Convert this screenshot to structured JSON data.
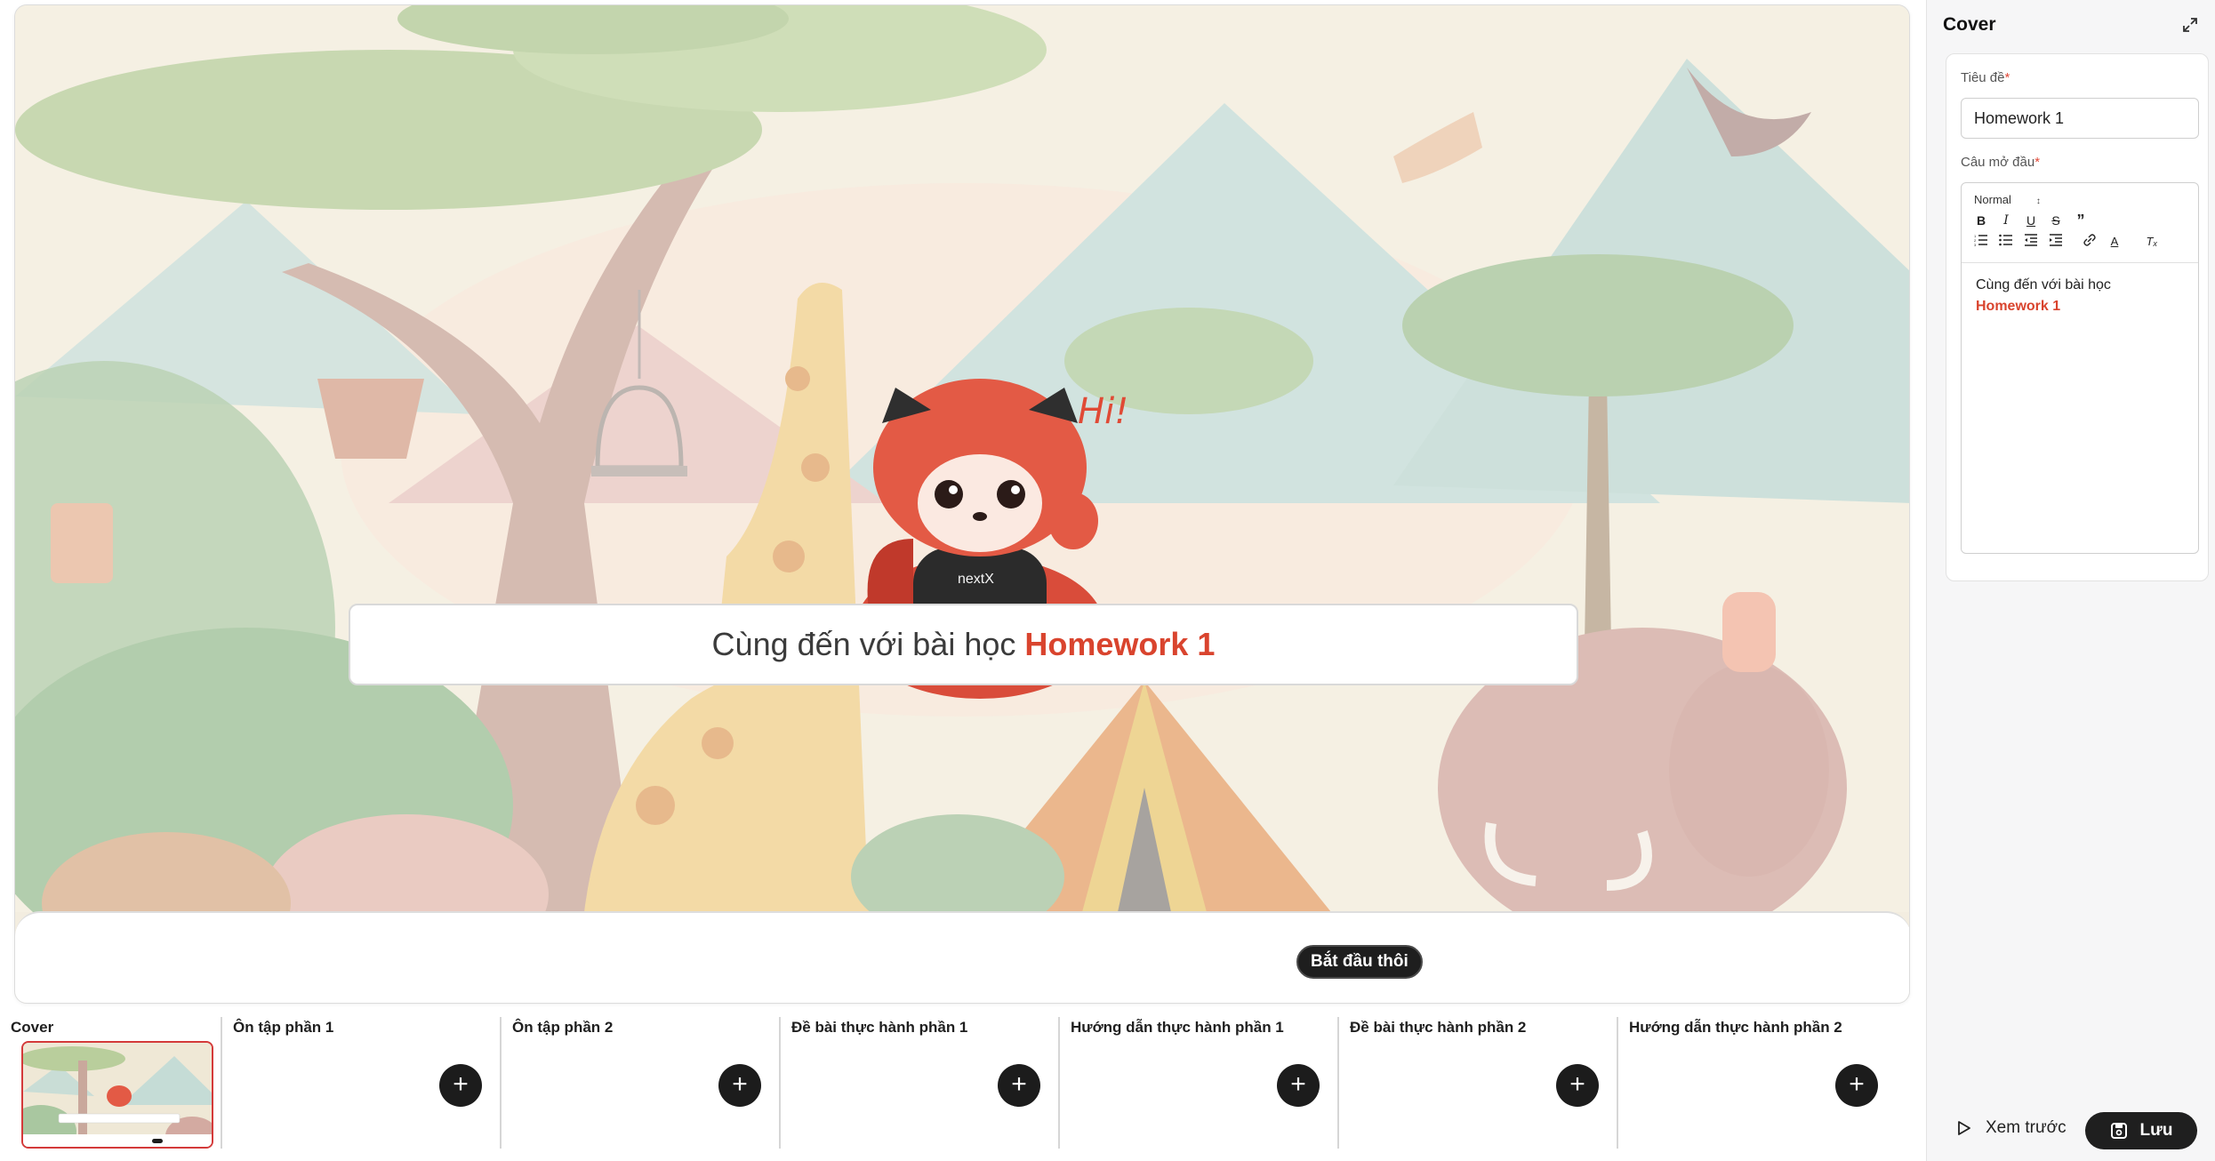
{
  "stage": {
    "greeting_prefix": "Cùng đến với bài học",
    "greeting_highlight": "Homework 1",
    "start_button": "Bắt đầu thôi",
    "mascot_bubble": "Hi!",
    "shirt_logo": "nextX"
  },
  "slides": [
    {
      "label": "Cover"
    },
    {
      "label": "Ôn tập phần 1"
    },
    {
      "label": "Ôn tập phần 2"
    },
    {
      "label": "Đề bài thực hành phần 1"
    },
    {
      "label": "Hướng dẫn thực hành phần 1"
    },
    {
      "label": "Đề bài thực hành phần 2"
    },
    {
      "label": "Hướng dẫn thực hành phần 2"
    }
  ],
  "add_symbol": "+",
  "panel": {
    "title": "Cover",
    "title_label": "Tiêu đề",
    "title_value": "Homework 1",
    "intro_label": "Câu mở đầu",
    "required_mark": "*",
    "format_select": "Normal",
    "intro_text": "Cùng đến với bài học",
    "intro_highlight": "Homework 1",
    "preview_button": "Xem trước",
    "save_button": "Lưu"
  },
  "colors": {
    "accent_red": "#d9442e",
    "dark_button": "#1f1f1f",
    "selected_border": "#d43a3a"
  }
}
